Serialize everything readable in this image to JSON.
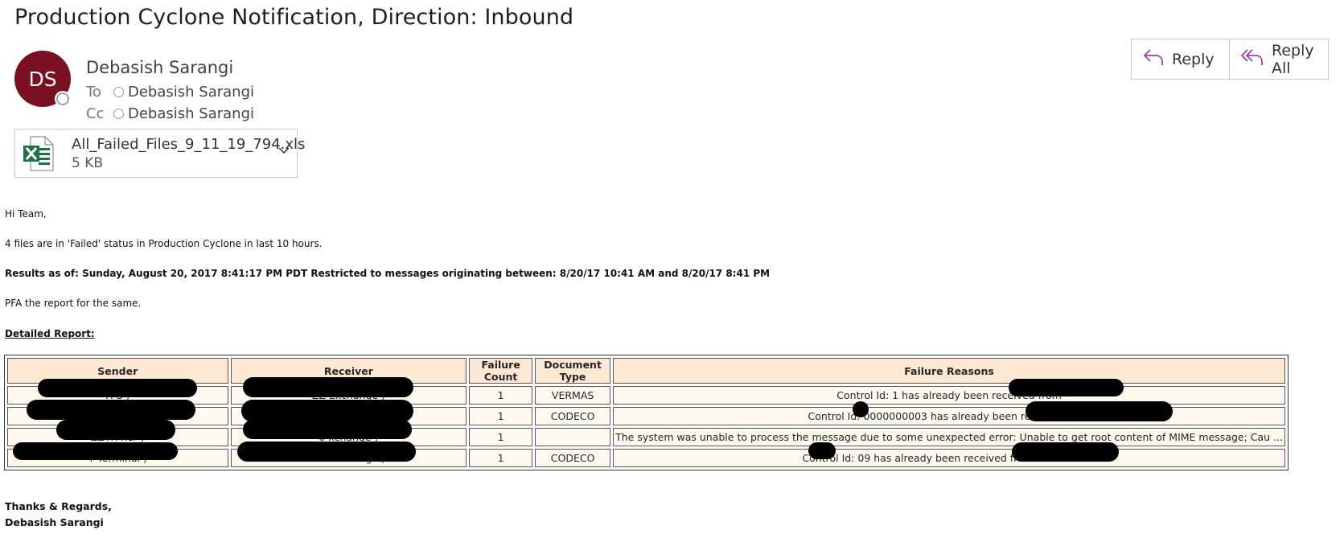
{
  "subject": "Production Cyclone Notification, Direction: Inbound",
  "sender": {
    "initials": "DS",
    "name": "Debasish Sarangi",
    "avatar_color": "#7a1021"
  },
  "recipients": {
    "to_label": "To",
    "to_name": "Debasish Sarangi",
    "cc_label": "Cc",
    "cc_name": "Debasish Sarangi"
  },
  "attachment": {
    "filename": "All_Failed_Files_9_11_19_794.xls",
    "size": "5 KB",
    "icon": "excel-icon"
  },
  "actions": {
    "reply_label": "Reply",
    "reply_all_label": "Reply All",
    "accent": "#a33ea1"
  },
  "body": {
    "greeting": "Hi Team,",
    "line1": "4 files are in 'Failed' status in Production Cyclone in last 10 hours.",
    "line2": "Results as of: Sunday, August 20, 2017 8:41:17 PM PDT Restricted to messages originating between: 8/20/17 10:41 AM and 8/20/17 8:41 PM",
    "line3": "PFA the report for the same.",
    "report_heading": "Detailed Report:"
  },
  "table": {
    "headers": [
      "Sender",
      "Receiver",
      "Failure Count",
      "Document Type",
      "Failure Reasons"
    ],
    "rows": [
      [
        "H                                                  S )",
        "ZZ                                                   Exchange )",
        "1",
        "VERMAS",
        "Control Id: 1 has already been received from"
      ],
      [
        "I                                                 TD )",
        "ZZ                                                   Exchange )",
        "1",
        "CODECO",
        "Control Id: 0000000003   has already been received from"
      ],
      [
        "ZZTR                                    ner )",
        "0                                                    xchange )",
        "1",
        "",
        "The system was unable to process the message due to some unexpected error: Unable to get root content of MIME message; Cau ..."
      ],
      [
        "Y                                        Terminal )",
        "ZZ                                                   Exchange )",
        "1",
        "CODECO",
        "Control Id: 09       has already been received from YN                      Terminal"
      ]
    ]
  },
  "signature": {
    "line1": "Thanks & Regards,",
    "line2": "Debasish Sarangi"
  }
}
